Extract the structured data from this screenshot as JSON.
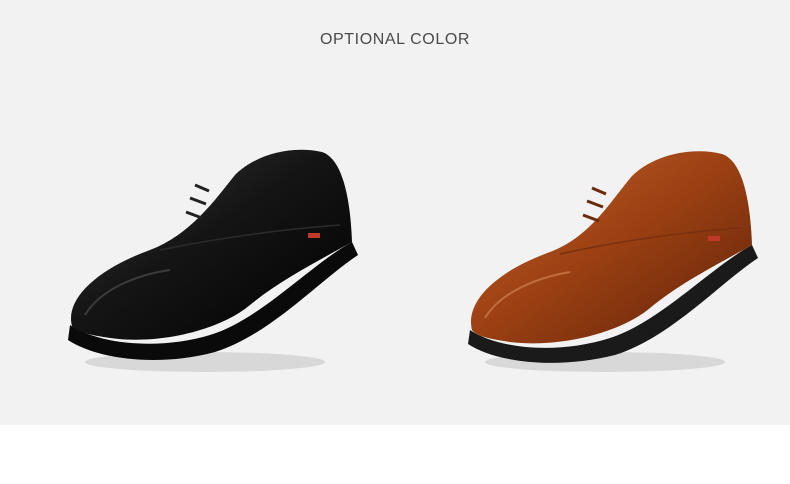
{
  "heading": "OPTIONAL COLOR",
  "shoes": [
    {
      "color_name": "black",
      "upper": "#151515",
      "shade": "#000000",
      "sole": "#0a0a0a"
    },
    {
      "color_name": "brown",
      "upper": "#9a3f12",
      "shade": "#5e220a",
      "sole": "#1a1a1a"
    }
  ],
  "colors": {
    "background": "#f2f2f2",
    "heading": "#4a4a4a",
    "accent_red": "#c0392b"
  }
}
